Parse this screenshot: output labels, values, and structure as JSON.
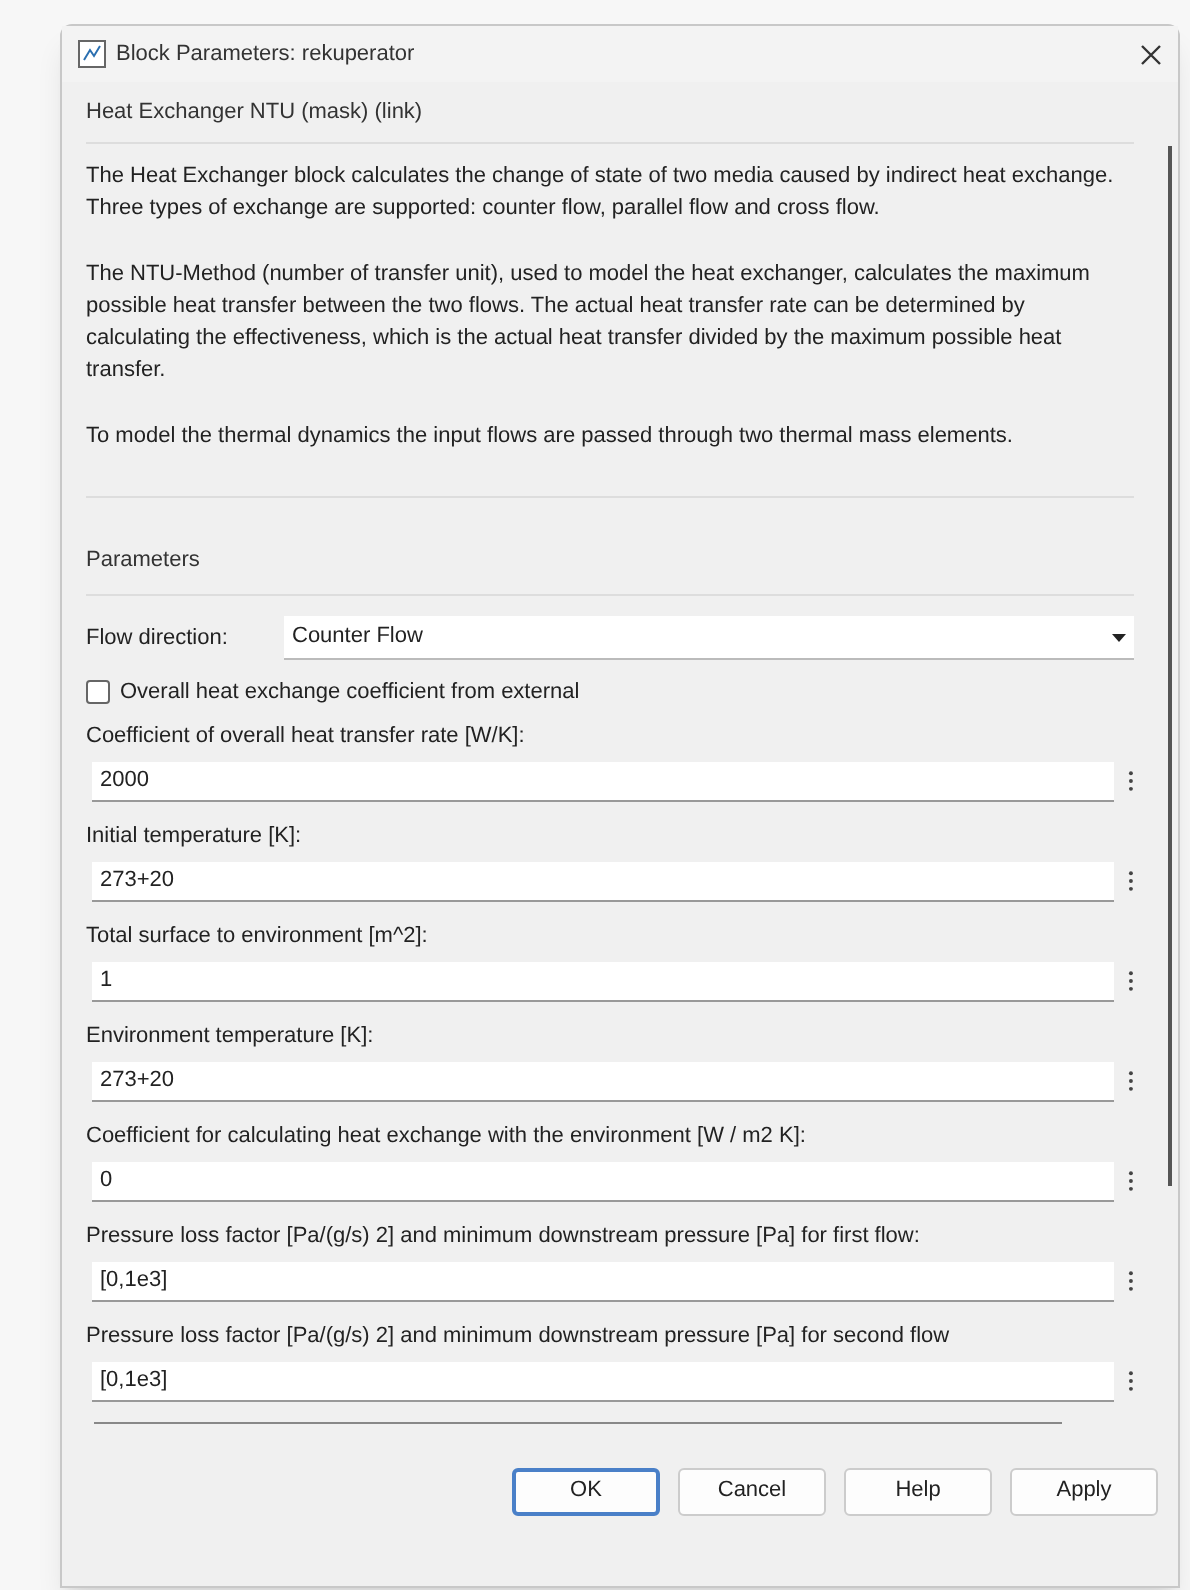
{
  "window": {
    "title": "Block Parameters: rekuperator"
  },
  "mask": {
    "title": "Heat Exchanger NTU (mask) (link)",
    "paragraphs": [
      "The Heat Exchanger block calculates the change of state of two media caused by indirect heat exchange. Three types of exchange are supported: counter flow, parallel flow and cross flow.",
      "The NTU-Method (number of transfer unit), used to model the heat exchanger, calculates the maximum possible heat transfer between the two flows. The actual heat transfer rate can be determined by calculating the effectiveness, which is the actual heat transfer divided by the maximum possible heat transfer.",
      "To model the thermal dynamics the input flows are passed through two thermal mass elements."
    ]
  },
  "parameters": {
    "title": "Parameters",
    "items": [
      {
        "kind": "dropdown",
        "label": "Flow direction:",
        "value": "Counter Flow"
      },
      {
        "kind": "checkbox",
        "label": "Overall heat exchange coefficient from external",
        "checked": false
      },
      {
        "kind": "edit",
        "label": "Coefficient of overall heat transfer rate [W/K]:",
        "value": "2000"
      },
      {
        "kind": "edit",
        "label": "Initial temperature [K]:",
        "value": "273+20"
      },
      {
        "kind": "edit",
        "label": "Total surface to environment  [m^2]:",
        "value": "1"
      },
      {
        "kind": "edit",
        "label": "Environment temperature [K]:",
        "value": "273+20"
      },
      {
        "kind": "edit",
        "label": "Coefficient for calculating heat exchange with the environment [W / m2 K]:",
        "value": "0"
      },
      {
        "kind": "edit",
        "label": "Pressure loss factor [Pa/(g/s) 2] and minimum downstream pressure [Pa] for first flow:",
        "value": "[0,1e3]"
      },
      {
        "kind": "edit",
        "label": "Pressure loss factor [Pa/(g/s) 2] and minimum downstream pressure [Pa] for second flow",
        "value": "[0,1e3]"
      }
    ]
  },
  "buttons": [
    {
      "label": "OK",
      "selected": true
    },
    {
      "label": "Cancel",
      "selected": false
    },
    {
      "label": "Help",
      "selected": false
    },
    {
      "label": "Apply",
      "selected": false
    }
  ]
}
